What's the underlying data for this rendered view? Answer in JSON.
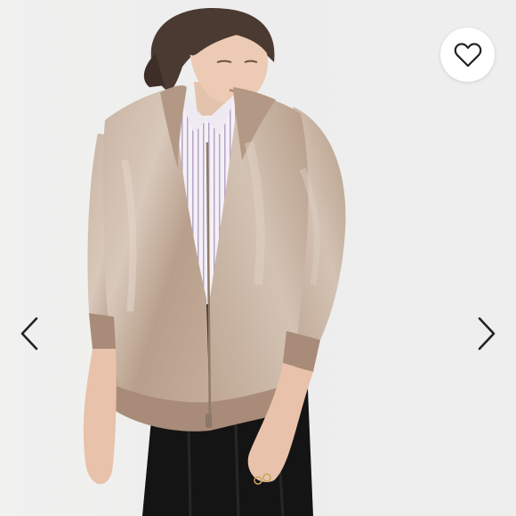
{
  "gallery": {
    "photo_icon": "product-photo-jacket",
    "favorite_icon": "heart-outline-icon",
    "prev_icon": "chevron-left-icon",
    "next_icon": "chevron-right-icon"
  },
  "colors": {
    "background": "#eeeeee",
    "jacket": "#c2ab98",
    "jacket_highlight": "#d8c8ba",
    "jacket_rib": "#a88b78",
    "skirt": "#141414",
    "shirt_stripe": "#b7a3c8",
    "icon": "#222222",
    "button_bg": "#ffffff"
  }
}
